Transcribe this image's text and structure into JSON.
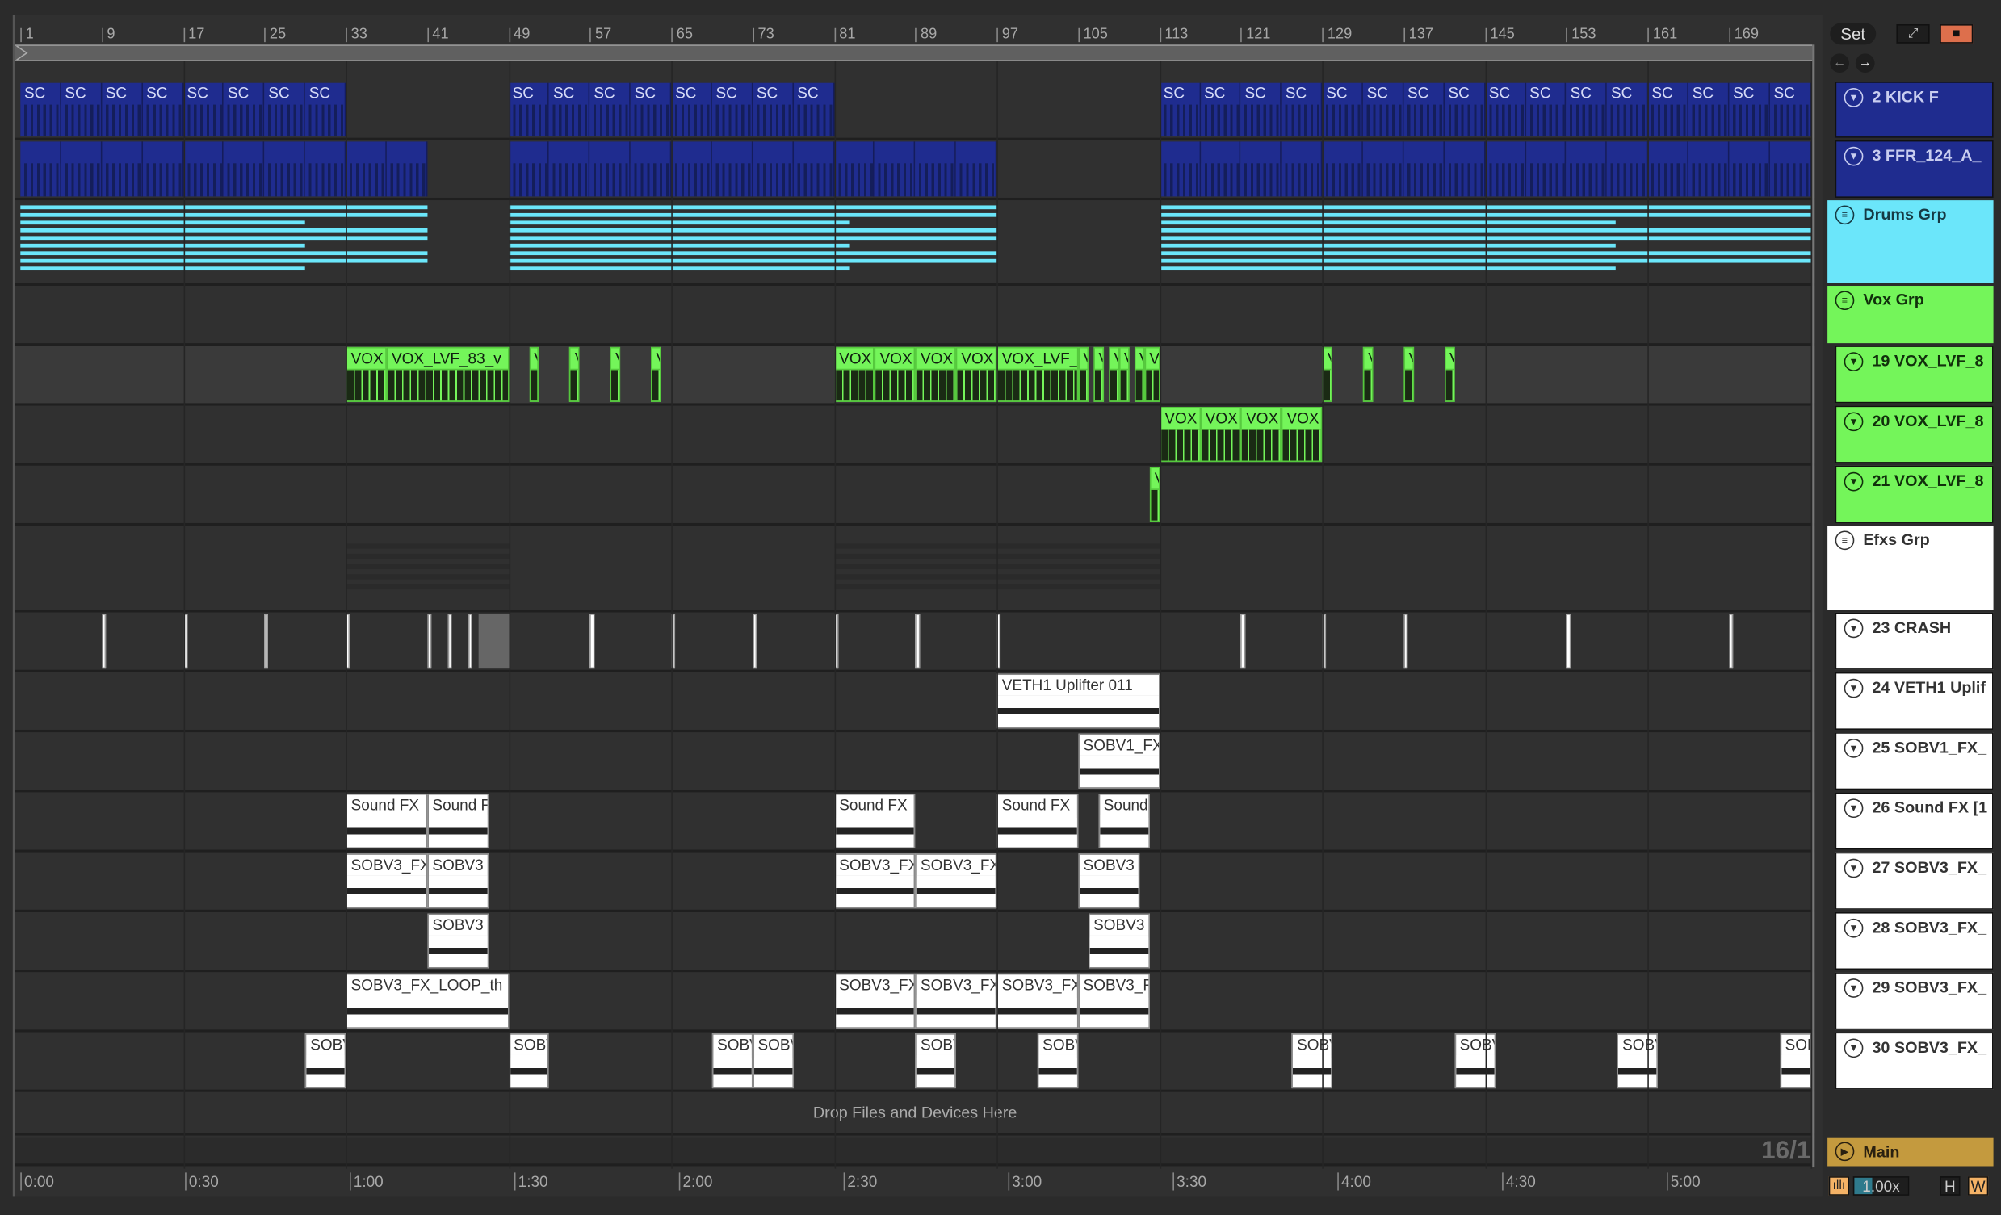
{
  "ruler": {
    "bars": [
      "1",
      "9",
      "17",
      "25",
      "33",
      "41",
      "49",
      "57",
      "65",
      "73",
      "81",
      "89",
      "97",
      "105",
      "113",
      "121",
      "129",
      "137",
      "145",
      "153",
      "161",
      "169"
    ]
  },
  "time_ruler": {
    "labels": [
      "0:00",
      "0:30",
      "1:00",
      "1:30",
      "2:00",
      "2:30",
      "3:00",
      "3:30",
      "4:00",
      "4:30",
      "5:00"
    ]
  },
  "controls": {
    "set_label": "Set",
    "zoom_level": "1.00x",
    "h_label": "H",
    "w_label": "W",
    "grid_readout": "16/1"
  },
  "colors": {
    "blue": "#1f2c8f",
    "cyan": "#6be6fa",
    "green": "#74f55a",
    "white": "#ffffff",
    "main": "#c49a3e",
    "lock": "#dd6f4c"
  },
  "tracks": [
    {
      "name": "2 KICK F",
      "type": "blue",
      "icon": "triangle-down-icon"
    },
    {
      "name": "3 FFR_124_A_",
      "type": "blue",
      "icon": "triangle-down-icon"
    },
    {
      "name": "Drums Grp",
      "type": "cyan",
      "icon": "group-icon"
    },
    {
      "name": "Vox Grp",
      "type": "green",
      "icon": "group-icon"
    },
    {
      "name": "19 VOX_LVF_8",
      "type": "green",
      "icon": "triangle-down-icon"
    },
    {
      "name": "20 VOX_LVF_8",
      "type": "green",
      "icon": "triangle-down-icon"
    },
    {
      "name": "21 VOX_LVF_8",
      "type": "green",
      "icon": "triangle-down-icon"
    },
    {
      "name": "Efxs Grp",
      "type": "white",
      "icon": "group-icon"
    },
    {
      "name": "23 CRASH",
      "type": "white",
      "icon": "triangle-down-icon"
    },
    {
      "name": "24 VETH1 Uplif",
      "type": "white",
      "icon": "triangle-down-icon"
    },
    {
      "name": "25 SOBV1_FX_",
      "type": "white",
      "icon": "triangle-down-icon"
    },
    {
      "name": "26 Sound FX [1",
      "type": "white",
      "icon": "triangle-down-icon"
    },
    {
      "name": "27 SOBV3_FX_",
      "type": "white",
      "icon": "triangle-down-icon"
    },
    {
      "name": "28 SOBV3_FX_",
      "type": "white",
      "icon": "triangle-down-icon"
    },
    {
      "name": "29 SOBV3_FX_",
      "type": "white",
      "icon": "triangle-down-icon"
    },
    {
      "name": "30 SOBV3_FX_",
      "type": "white",
      "icon": "triangle-down-icon"
    }
  ],
  "main_track": {
    "name": "Main"
  },
  "drop_hint": "Drop Files and Devices Here",
  "clips": {
    "0": [
      [
        1,
        33,
        4,
        "SC"
      ],
      [
        49,
        81,
        4,
        "SC"
      ],
      [
        113,
        177,
        4,
        "SC"
      ]
    ],
    "1": [
      [
        1,
        41,
        4,
        ""
      ],
      [
        49,
        97,
        4,
        ""
      ],
      [
        113,
        177,
        4,
        ""
      ]
    ],
    "4": [
      [
        33,
        37,
        0,
        "VOX"
      ],
      [
        37,
        49,
        0,
        "VOX_LVF_83_v"
      ],
      [
        51,
        52,
        0,
        "V"
      ],
      [
        55,
        56,
        0,
        "V"
      ],
      [
        59,
        60,
        0,
        "V"
      ],
      [
        63,
        64,
        0,
        "V"
      ],
      [
        81,
        85,
        0,
        "VOX"
      ],
      [
        85,
        89,
        0,
        "VOX"
      ],
      [
        89,
        93,
        0,
        "VOX"
      ],
      [
        93,
        97,
        0,
        "VOX"
      ],
      [
        97,
        105,
        0,
        "VOX_LVF_"
      ],
      [
        105,
        106,
        0,
        "V"
      ],
      [
        106.5,
        107.5,
        0,
        "V"
      ],
      [
        108,
        109,
        0,
        "V"
      ],
      [
        109,
        110,
        0,
        "V"
      ],
      [
        110.5,
        111.5,
        0,
        "V"
      ],
      [
        111.5,
        113,
        0,
        "VO"
      ],
      [
        129,
        130,
        0,
        "V"
      ],
      [
        133,
        134,
        0,
        "V"
      ],
      [
        137,
        138,
        0,
        "V"
      ],
      [
        141,
        142,
        0,
        "V"
      ]
    ],
    "5": [
      [
        113,
        117,
        0,
        "VOX"
      ],
      [
        117,
        121,
        0,
        "VOX"
      ],
      [
        121,
        125,
        0,
        "VOX"
      ],
      [
        125,
        129,
        0,
        "VOX"
      ]
    ],
    "6": [
      [
        112,
        113,
        0,
        "V"
      ]
    ],
    "8": [
      [
        9,
        9.4,
        0,
        ""
      ],
      [
        17,
        17.4,
        0,
        ""
      ],
      [
        25,
        25.4,
        0,
        ""
      ],
      [
        33,
        33.4,
        0,
        ""
      ],
      [
        41,
        41.4,
        0,
        ""
      ],
      [
        43,
        43.4,
        0,
        ""
      ],
      [
        45,
        45.4,
        0,
        ""
      ],
      [
        46,
        49,
        0,
        ""
      ],
      [
        57,
        57.4,
        0,
        ""
      ],
      [
        65,
        65.4,
        0,
        ""
      ],
      [
        73,
        73.4,
        0,
        ""
      ],
      [
        81,
        81.4,
        0,
        ""
      ],
      [
        89,
        89.4,
        0,
        ""
      ],
      [
        97,
        97.4,
        0,
        ""
      ],
      [
        121,
        121.4,
        0,
        ""
      ],
      [
        129,
        129.4,
        0,
        ""
      ],
      [
        137,
        137.4,
        0,
        ""
      ],
      [
        153,
        153.4,
        0,
        ""
      ],
      [
        169,
        169.4,
        0,
        ""
      ]
    ],
    "9": [
      [
        97,
        113,
        0,
        "VETH1 Uplifter 011"
      ]
    ],
    "10": [
      [
        105,
        113,
        0,
        "SOBV1_FX"
      ]
    ],
    "11": [
      [
        33,
        41,
        0,
        "Sound FX"
      ],
      [
        41,
        47,
        0,
        "Sound FX"
      ],
      [
        81,
        89,
        0,
        "Sound FX"
      ],
      [
        97,
        105,
        0,
        "Sound FX"
      ],
      [
        107,
        112,
        0,
        "Sound"
      ]
    ],
    "12": [
      [
        33,
        41,
        0,
        "SOBV3_FX"
      ],
      [
        41,
        47,
        0,
        "SOBV3"
      ],
      [
        81,
        89,
        0,
        "SOBV3_FX"
      ],
      [
        89,
        97,
        0,
        "SOBV3_FX"
      ],
      [
        105,
        111,
        0,
        "SOBV3"
      ]
    ],
    "13": [
      [
        41,
        47,
        0,
        "SOBV3"
      ],
      [
        106,
        112,
        0,
        "SOBV3"
      ]
    ],
    "14": [
      [
        33,
        49,
        0,
        "SOBV3_FX_LOOP_th"
      ],
      [
        81,
        89,
        0,
        "SOBV3_FX"
      ],
      [
        89,
        97,
        0,
        "SOBV3_FX"
      ],
      [
        97,
        105,
        0,
        "SOBV3_FX"
      ],
      [
        105,
        112,
        0,
        "SOBV3_F"
      ]
    ],
    "15": [
      [
        29,
        33,
        0,
        "SOBV"
      ],
      [
        49,
        53,
        0,
        "SOBV"
      ],
      [
        69,
        73,
        0,
        "SOBV"
      ],
      [
        73,
        77,
        0,
        "SOBV"
      ],
      [
        89,
        93,
        0,
        "SOBV"
      ],
      [
        101,
        105,
        0,
        "SOBV"
      ],
      [
        126,
        130,
        0,
        "SOBV"
      ],
      [
        142,
        146,
        0,
        "SOBV"
      ],
      [
        158,
        162,
        0,
        "SOBV"
      ],
      [
        174,
        177,
        0,
        "SOBV"
      ]
    ]
  }
}
